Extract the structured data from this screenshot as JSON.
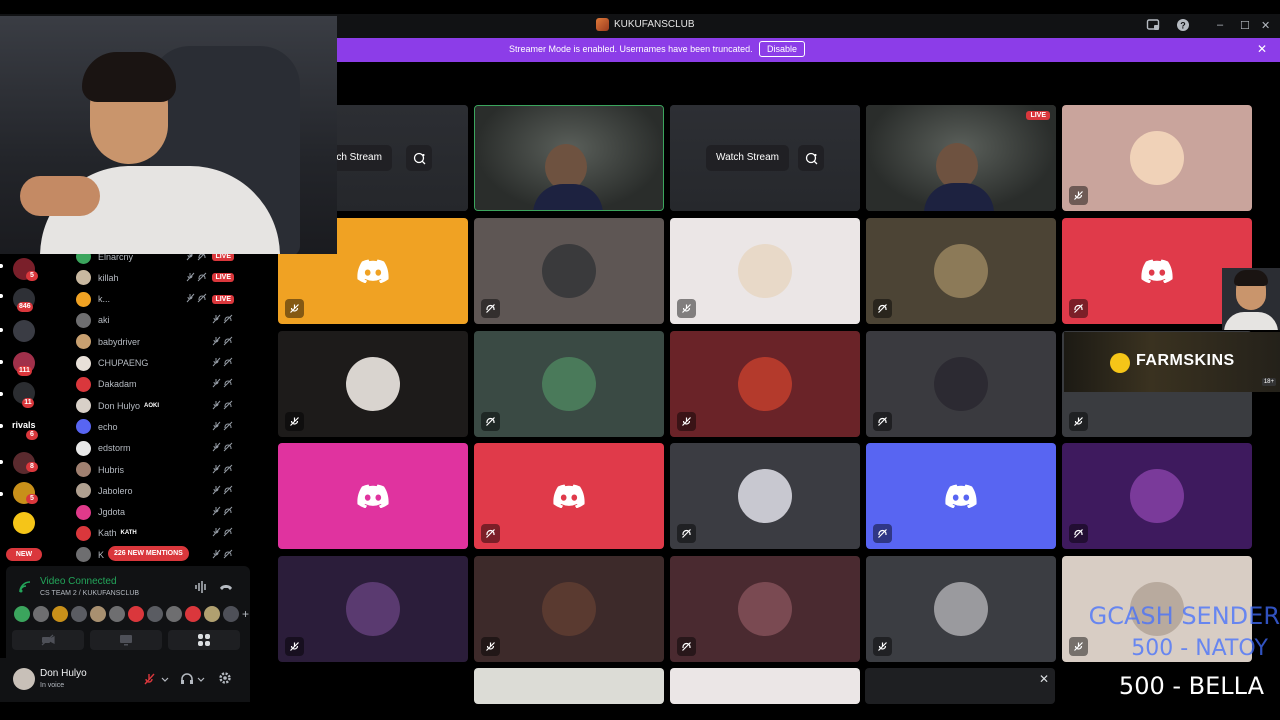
{
  "window": {
    "title": "KUKUFANSCLUB",
    "minimize_glyph": "–",
    "maximize_glyph": "☐",
    "close_glyph": "✕",
    "help_glyph": "?"
  },
  "banner": {
    "message": "Streamer Mode is enabled. Usernames have been truncated.",
    "button_label": "Disable",
    "close_glyph": "✕"
  },
  "stage": {
    "watch_stream_label": "Watch Stream",
    "watch_stream_label_clipped": "atch Stream",
    "live_label": "LIVE"
  },
  "servers": {
    "badges": [
      "5",
      "846",
      "111",
      "11",
      "6",
      "8",
      "5"
    ],
    "rivals_label": "rivals",
    "new_label": "NEW"
  },
  "members": {
    "new_mentions": "226 NEW MENTIONS",
    "live_label": "LIVE",
    "rows": [
      {
        "name": "Elnarcny",
        "live": true
      },
      {
        "name": "killah",
        "live": true
      },
      {
        "name": "k...",
        "live": true
      },
      {
        "name": "aki",
        "live": false
      },
      {
        "name": "babydriver",
        "live": false
      },
      {
        "name": "CHUPAENG",
        "live": false
      },
      {
        "name": "Dakadam",
        "live": false
      },
      {
        "name": "Don Hulyo",
        "live": false,
        "tag": "AOKI"
      },
      {
        "name": "echo",
        "live": false
      },
      {
        "name": "edstorm",
        "live": false
      },
      {
        "name": "Hubris",
        "live": false
      },
      {
        "name": "Jabolero",
        "live": false
      },
      {
        "name": "Jgdota",
        "live": false
      },
      {
        "name": "Kath",
        "live": false,
        "tag": "KATH"
      },
      {
        "name": "K",
        "live": false
      }
    ]
  },
  "voice": {
    "status": "Video Connected",
    "channel": "CS TEAM 2 / KUKUFANSCLUB"
  },
  "user": {
    "name": "Don Hulyo",
    "status": "In voice"
  },
  "overlays": {
    "sponsor": "FARMSKINS",
    "sponsor_age": "18+",
    "donation_1": "GCASH SENDER",
    "donation_2": "500 - NATOY",
    "donation_3": "500  - BELLA"
  },
  "colors": {
    "accent_purple": "#8c3de8",
    "live_red": "#da373c",
    "connected_green": "#23a55a",
    "discord_blurple": "#5865f2"
  }
}
